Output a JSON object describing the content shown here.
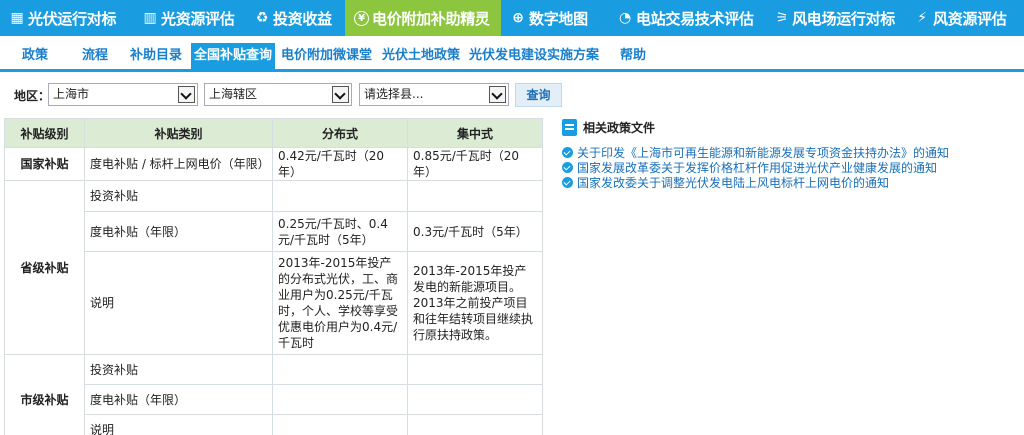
{
  "topnav": [
    {
      "label": "光伏运行对标",
      "icon": "grid-icon"
    },
    {
      "label": "光资源评估",
      "icon": "bar-chart-icon"
    },
    {
      "label": "投资收益",
      "icon": "recycle-icon"
    },
    {
      "label": "电价附加补助精灵",
      "icon": "yen-icon",
      "active": true
    },
    {
      "label": "数字地图",
      "icon": "globe-icon"
    },
    {
      "label": "电站交易技术评估",
      "icon": "gauge-icon"
    },
    {
      "label": "风电场运行对标",
      "icon": "windmill-icon"
    },
    {
      "label": "风资源评估",
      "icon": "lightning-icon"
    }
  ],
  "subnav": [
    "政策",
    "流程",
    "补助目录",
    "全国补贴查询",
    "电价附加微课堂",
    "光伏土地政策",
    "光伏发电建设实施方案",
    "帮助"
  ],
  "filter": {
    "label": "地区：",
    "region": "上海市",
    "district": "上海辖区",
    "county_placeholder": "请选择县...",
    "query_label": "查询"
  },
  "table": {
    "headers": [
      "补贴级别",
      "补贴类别",
      "分布式",
      "集中式"
    ],
    "national": {
      "level": "国家补贴",
      "category": "度电补贴 / 标杆上网电价（年限）",
      "distributed": "0.42元/千瓦时（20年）",
      "centralized": "0.85元/千瓦时（20年）"
    },
    "provincial": {
      "level": "省级补贴",
      "rows": [
        {
          "category": "投资补贴",
          "distributed": "",
          "centralized": ""
        },
        {
          "category": "度电补贴（年限）",
          "distributed": "0.25元/千瓦时、0.4元/千瓦时（5年）",
          "centralized": "0.3元/千瓦时（5年）"
        },
        {
          "category": "说明",
          "distributed": "2013年-2015年投产的分布式光伏，工、商业用户为0.25元/千瓦时，个人、学校等享受优惠电价用户为0.4元/千瓦时",
          "centralized": "2013年-2015年投产发电的新能源项目。2013年之前投产项目和往年结转项目继续执行原扶持政策。"
        }
      ]
    },
    "municipal": {
      "level": "市级补贴",
      "rows": [
        {
          "category": "投资补贴",
          "distributed": "",
          "centralized": ""
        },
        {
          "category": "度电补贴（年限）",
          "distributed": "",
          "centralized": ""
        },
        {
          "category": "说明",
          "distributed": "",
          "centralized": ""
        }
      ]
    }
  },
  "related": {
    "title": "相关政策文件",
    "links": [
      "关于印发《上海市可再生能源和新能源发展专项资金扶持办法》的通知",
      "国家发展改革委关于发挥价格杠杆作用促进光伏产业健康发展的通知",
      "国家发改委关于调整光伏发电陆上风电标杆上网电价的通知"
    ]
  },
  "colors": {
    "nav_blue": "#1a9de0",
    "active_green": "#8cc63e",
    "header_green": "#dcebd3",
    "link_blue": "#1a6fb8"
  }
}
